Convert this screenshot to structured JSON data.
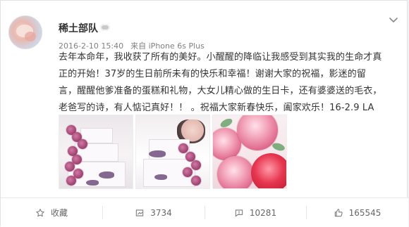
{
  "post": {
    "username": "稀土部队",
    "meta": {
      "date": "2016-2-10 15:40",
      "via": "来自",
      "device": "iPhone 6s Plus"
    },
    "text_lines": [
      "去年本命年，我收获了所有的美好。小醒醒的降临让我感受到其实我的生命才真",
      "正的开始！37岁的生日前所未有的快乐和幸福！谢谢大家的祝福，影迷的留",
      "言，醒醒他爹准备的蛋糕和礼物，大女儿精心做的生日卡，还有婆婆送的毛衣，",
      "老爸写的诗，有人惦记真好！！ 。祝福大家新春快乐，阖家欢乐！16-2.9 LA"
    ]
  },
  "actions": {
    "collect": {
      "label": "收藏"
    },
    "forward": {
      "count": "3734"
    },
    "comment": {
      "count": "10281"
    },
    "like": {
      "count": "165545"
    }
  },
  "icons": {
    "menu": "chevron-down-icon",
    "collect": "star-icon",
    "forward": "share-icon",
    "comment": "comment-icon",
    "like": "thumbs-up-icon"
  }
}
